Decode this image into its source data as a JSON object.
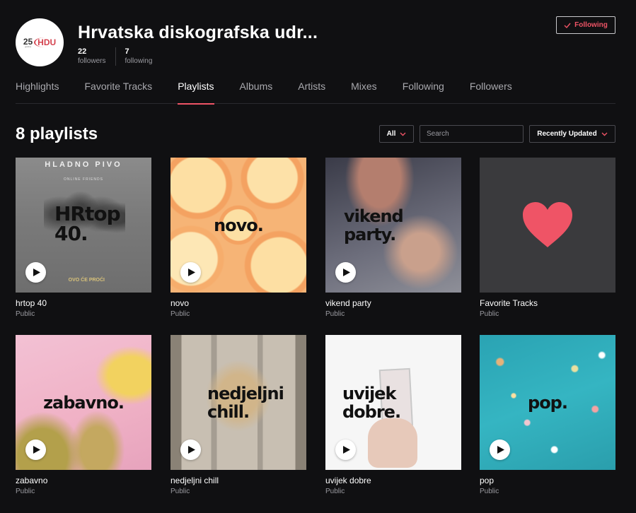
{
  "profile": {
    "avatar_badge_year": "25",
    "avatar_badge_sub": "godina",
    "avatar_badge_brand": "HDU",
    "name": "Hrvatska diskografska udr...",
    "followers_count": "22",
    "followers_label": "followers",
    "following_count": "7",
    "following_label": "following",
    "follow_button_label": "Following"
  },
  "tabs": [
    "Highlights",
    "Favorite Tracks",
    "Playlists",
    "Albums",
    "Artists",
    "Mixes",
    "Following",
    "Followers"
  ],
  "active_tab": "Playlists",
  "toolbar": {
    "title": "8 playlists",
    "filter_value": "All",
    "search_placeholder": "Search",
    "sort_value": "Recently Updated"
  },
  "playlists": [
    {
      "title": "hrtop 40",
      "visibility": "Public",
      "cover_text": "HRtop 40.",
      "band_text": "HLADNO PIVO",
      "sub_text": "ONLINE FRIENDS",
      "tag_text": "OVO ĆE PROĆI"
    },
    {
      "title": "novo",
      "visibility": "Public",
      "cover_text": "novo."
    },
    {
      "title": "vikend party",
      "visibility": "Public",
      "cover_text": "vikend party."
    },
    {
      "title": "Favorite Tracks",
      "visibility": "Public",
      "cover_text": ""
    },
    {
      "title": "zabavno",
      "visibility": "Public",
      "cover_text": "zabavno."
    },
    {
      "title": "nedjeljni chill",
      "visibility": "Public",
      "cover_text": "nedjeljni chill."
    },
    {
      "title": "uvijek dobre",
      "visibility": "Public",
      "cover_text": "uvijek dobre."
    },
    {
      "title": "pop",
      "visibility": "Public",
      "cover_text": "pop."
    }
  ],
  "colors": {
    "accent": "#ef5466",
    "background": "#101012",
    "heart": "#ef5466"
  }
}
